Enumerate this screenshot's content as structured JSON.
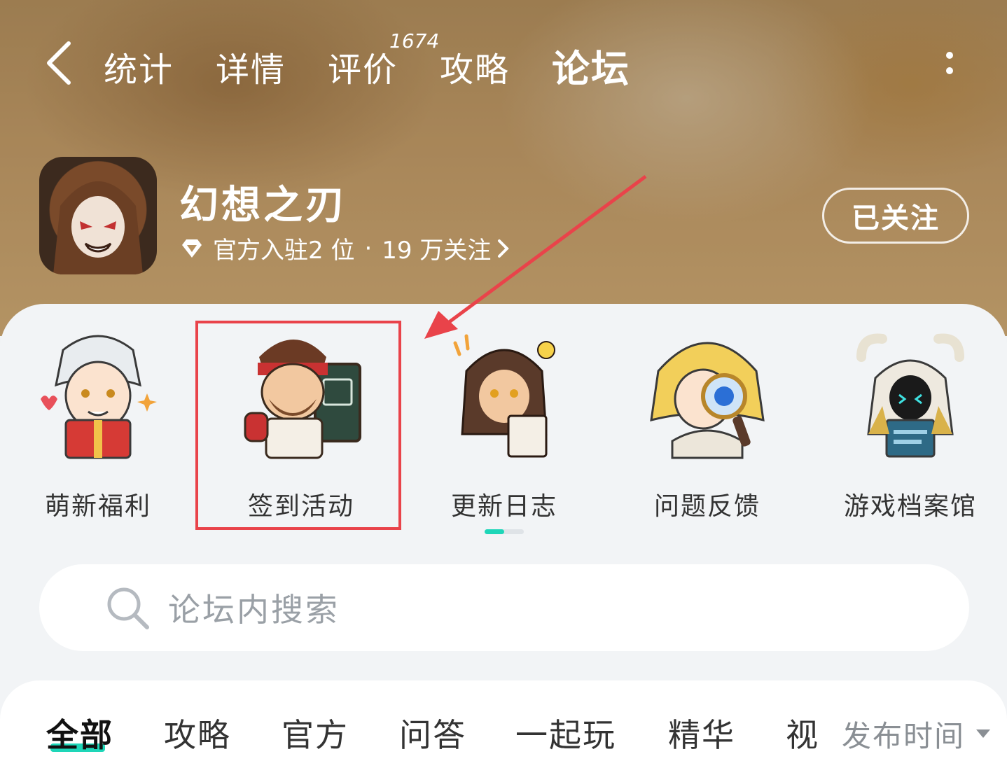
{
  "nav": {
    "tabs": [
      {
        "label": "统计"
      },
      {
        "label": "详情"
      },
      {
        "label": "评价"
      },
      {
        "label": "攻略"
      },
      {
        "label": "论坛"
      }
    ],
    "review_count": "1674",
    "active_tab": "论坛"
  },
  "game": {
    "title": "幻想之刃",
    "official": "官方入驻2 位",
    "separator": "·",
    "followers": "19 万关注",
    "follow_label": "已关注"
  },
  "shortcuts": [
    {
      "label": "萌新福利",
      "icon": "gift-character-icon"
    },
    {
      "label": "签到活动",
      "icon": "checkin-character-icon"
    },
    {
      "label": "更新日志",
      "icon": "notes-character-icon"
    },
    {
      "label": "问题反馈",
      "icon": "magnifier-character-icon"
    },
    {
      "label": "游戏档案馆",
      "icon": "archive-character-icon"
    }
  ],
  "search": {
    "placeholder": "论坛内搜索"
  },
  "feed_tabs": [
    {
      "label": "全部"
    },
    {
      "label": "攻略"
    },
    {
      "label": "官方"
    },
    {
      "label": "问答"
    },
    {
      "label": "一起玩"
    },
    {
      "label": "精华"
    },
    {
      "label": "视"
    }
  ],
  "sort": {
    "label": "发布时间"
  },
  "colors": {
    "accent": "#1ed6b8",
    "annotation": "#e9434a"
  }
}
